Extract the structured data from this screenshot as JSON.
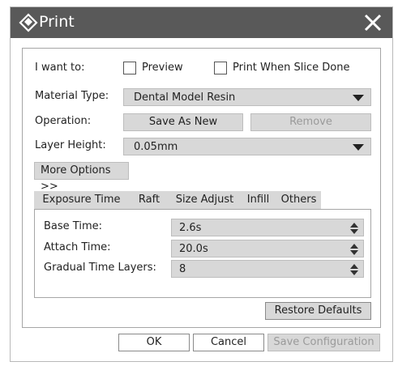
{
  "window": {
    "title": "Print",
    "icon": "app-diamond-icon",
    "close_icon": "close-icon"
  },
  "form": {
    "i_want_to_label": "I want to:",
    "preview_label": "Preview",
    "preview_checked": false,
    "print_when_slice_done_label": "Print When Slice Done",
    "print_when_slice_done_checked": false,
    "material_type_label": "Material Type:",
    "material_type_value": "Dental Model Resin",
    "operation_label": "Operation:",
    "save_as_new_label": "Save As New",
    "remove_label": "Remove",
    "layer_height_label": "Layer Height:",
    "layer_height_value": "0.05mm",
    "more_options_label": "More Options >>"
  },
  "tabs": [
    {
      "label": "Exposure Time",
      "active": true
    },
    {
      "label": "Raft",
      "active": false
    },
    {
      "label": "Size Adjust",
      "active": false
    },
    {
      "label": "Infill",
      "active": false
    },
    {
      "label": "Others",
      "active": false
    }
  ],
  "exposure": {
    "base_time_label": "Base Time:",
    "base_time_value": "2.6s",
    "attach_time_label": "Attach Time:",
    "attach_time_value": "20.0s",
    "gradual_layers_label": "Gradual Time Layers:",
    "gradual_layers_value": "8"
  },
  "buttons": {
    "restore_defaults": "Restore Defaults",
    "ok": "OK",
    "cancel": "Cancel",
    "save_configuration": "Save Configuration"
  },
  "colors": {
    "titlebar": "#595959",
    "control_bg": "#d8d8d8",
    "disabled_text": "#9a9a9a"
  }
}
